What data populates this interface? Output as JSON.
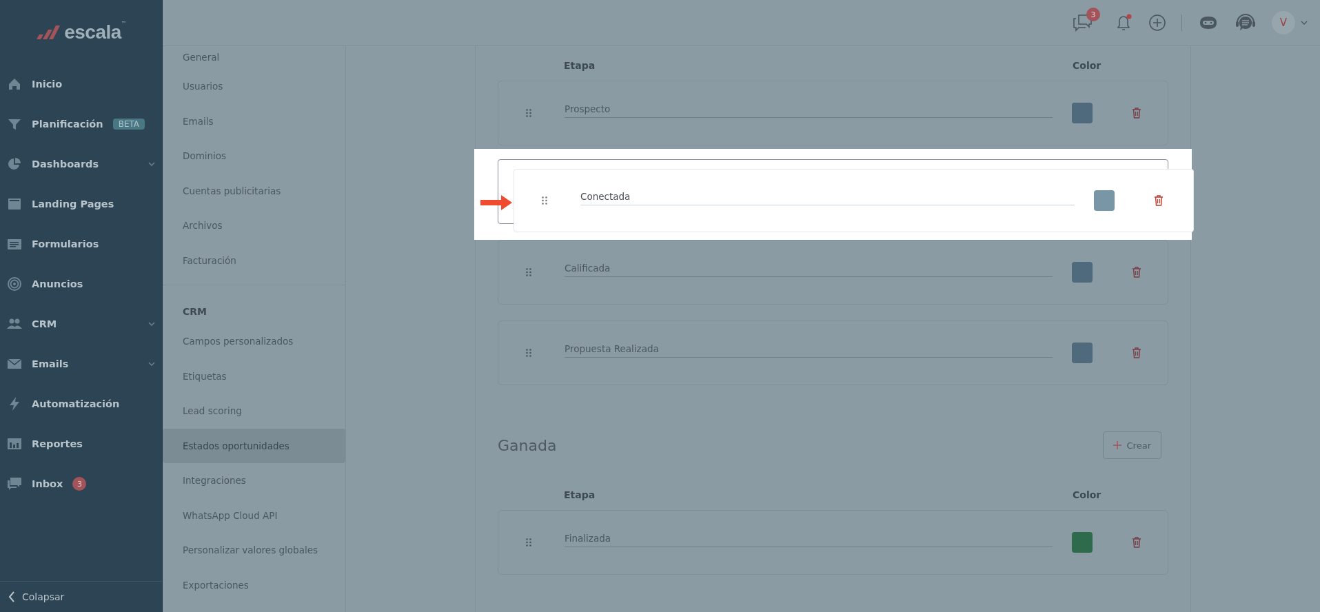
{
  "sidebar": {
    "logo": {
      "text": "escala",
      "mark": "™"
    },
    "items": [
      {
        "label": "Inicio",
        "kind": "link"
      },
      {
        "label": "Planificación",
        "kind": "link",
        "badge": "BETA"
      },
      {
        "label": "Dashboards",
        "kind": "group"
      },
      {
        "label": "Landing Pages",
        "kind": "link"
      },
      {
        "label": "Formularios",
        "kind": "link"
      },
      {
        "label": "Anuncios",
        "kind": "link"
      },
      {
        "label": "CRM",
        "kind": "group"
      },
      {
        "label": "Emails",
        "kind": "group"
      },
      {
        "label": "Automatización",
        "kind": "link"
      },
      {
        "label": "Reportes",
        "kind": "link"
      },
      {
        "label": "Inbox",
        "kind": "link",
        "count": "3"
      }
    ],
    "collapse": "Colapsar"
  },
  "topbar": {
    "chat_count": "3",
    "notifications_unread": true,
    "avatar": "V"
  },
  "settings_menu": {
    "sections": [
      {
        "items": [
          {
            "label": "General",
            "selected": false
          },
          {
            "label": "Usuarios",
            "selected": false
          },
          {
            "label": "Emails",
            "selected": false
          },
          {
            "label": "Dominios",
            "selected": false
          },
          {
            "label": "Cuentas publicitarias",
            "selected": false
          },
          {
            "label": "Archivos",
            "selected": false
          },
          {
            "label": "Facturación",
            "selected": false
          }
        ]
      },
      {
        "title": "CRM",
        "items": [
          {
            "label": "Campos personalizados",
            "selected": false
          },
          {
            "label": "Etiquetas",
            "selected": false
          },
          {
            "label": "Lead scoring",
            "selected": false
          },
          {
            "label": "Estados oportunidades",
            "selected": true
          },
          {
            "label": "Integraciones",
            "selected": false
          },
          {
            "label": "WhatsApp Cloud API",
            "selected": false
          },
          {
            "label": "Personalizar valores globales",
            "selected": false
          },
          {
            "label": "Exportaciones",
            "selected": false
          }
        ]
      }
    ]
  },
  "stage_groups": [
    {
      "columns": [
        "Etapa",
        "Color"
      ],
      "stages": [
        {
          "name": "Prospecto",
          "color": "#4f6a7c",
          "dragging": false
        },
        {
          "name": "Conectada",
          "color": "#7896a6",
          "dragging": true
        },
        {
          "name": "Calificada",
          "color": "#4f6a7c",
          "dragging": false
        },
        {
          "name": "Propuesta Realizada",
          "color": "#4f6a7c",
          "dragging": false
        }
      ]
    },
    {
      "title": "Ganada",
      "button": "Crear",
      "columns": [
        "Etapa",
        "Color"
      ],
      "stages": [
        {
          "name": "Finalizada",
          "color": "#2e6b4c",
          "dragging": false
        }
      ]
    }
  ]
}
